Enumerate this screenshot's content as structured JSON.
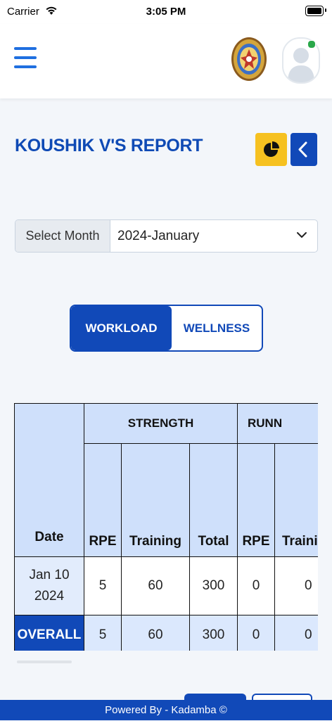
{
  "status_bar": {
    "carrier": "Carrier",
    "time": "3:05 PM"
  },
  "header": {
    "logo": "association-seal-logo",
    "avatar": "default-user-avatar"
  },
  "page": {
    "title": "KOUSHIK V'S REPORT"
  },
  "month_select": {
    "label": "Select Month",
    "value": "2024-January"
  },
  "segment": {
    "active": "WORKLOAD",
    "inactive": "WELLNESS"
  },
  "table": {
    "date_header": "Date",
    "groups": [
      "STRENGTH",
      "RUNN"
    ],
    "sub_headers": [
      "RPE",
      "Training",
      "Total",
      "RPE",
      "Traini"
    ],
    "rows": [
      {
        "date_line1": "Jan 10",
        "date_line2": "2024",
        "cells": [
          "5",
          "60",
          "300",
          "0",
          "0"
        ]
      }
    ],
    "overall": {
      "label": "OVERALL",
      "cells": [
        "5",
        "60",
        "300",
        "0",
        "0"
      ]
    }
  },
  "footer": {
    "text": "Powered By - Kadamba ©"
  },
  "colors": {
    "primary": "#1149b8",
    "accent_yellow": "#f6c120",
    "header_fill": "#cfe0fb",
    "title": "#0f4ab5"
  }
}
